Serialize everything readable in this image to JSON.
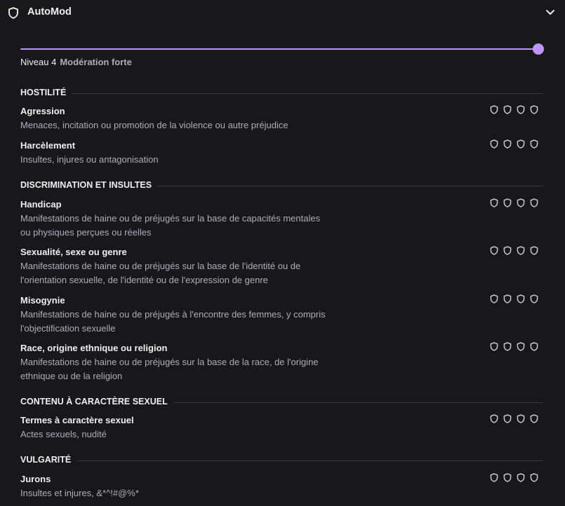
{
  "header": {
    "title": "AutoMod",
    "icon": "shield-icon",
    "toggle_icon": "chevron-down-icon"
  },
  "level": {
    "label": "Niveau 4",
    "description": "Modération forte",
    "value": 4,
    "max": 4
  },
  "colors": {
    "accent": "#bf94ff",
    "background": "#18181b",
    "text": "#efeff1",
    "muted": "#adadb8"
  },
  "sections": [
    {
      "title": "HOSTILITÉ",
      "items": [
        {
          "title": "Agression",
          "desc": "Menaces, incitation ou promotion de la violence ou autre préjudice"
        },
        {
          "title": "Harcèlement",
          "desc": "Insultes, injures ou antagonisation"
        }
      ]
    },
    {
      "title": "DISCRIMINATION ET INSULTES",
      "items": [
        {
          "title": "Handicap",
          "desc": "Manifestations de haine ou de préjugés sur la base de capacités mentales ou physiques perçues ou réelles"
        },
        {
          "title": "Sexualité, sexe ou genre",
          "desc": "Manifestations de haine ou de préjugés sur la base de l'identité ou de l'orientation sexuelle, de l'identité ou de l'expression de genre"
        },
        {
          "title": "Misogynie",
          "desc": "Manifestations de haine ou de préjugés à l'encontre des femmes, y compris l'objectification sexuelle"
        },
        {
          "title": "Race, origine ethnique ou religion",
          "desc": "Manifestations de haine ou de préjugés sur la base de la race, de l'origine ethnique ou de la religion"
        }
      ]
    },
    {
      "title": "CONTENU À CARACTÈRE SEXUEL",
      "items": [
        {
          "title": "Termes à caractère sexuel",
          "desc": "Actes sexuels, nudité"
        }
      ]
    },
    {
      "title": "VULGARITÉ",
      "items": [
        {
          "title": "Jurons",
          "desc": "Insultes et injures, &*^!#@%*"
        }
      ]
    }
  ]
}
